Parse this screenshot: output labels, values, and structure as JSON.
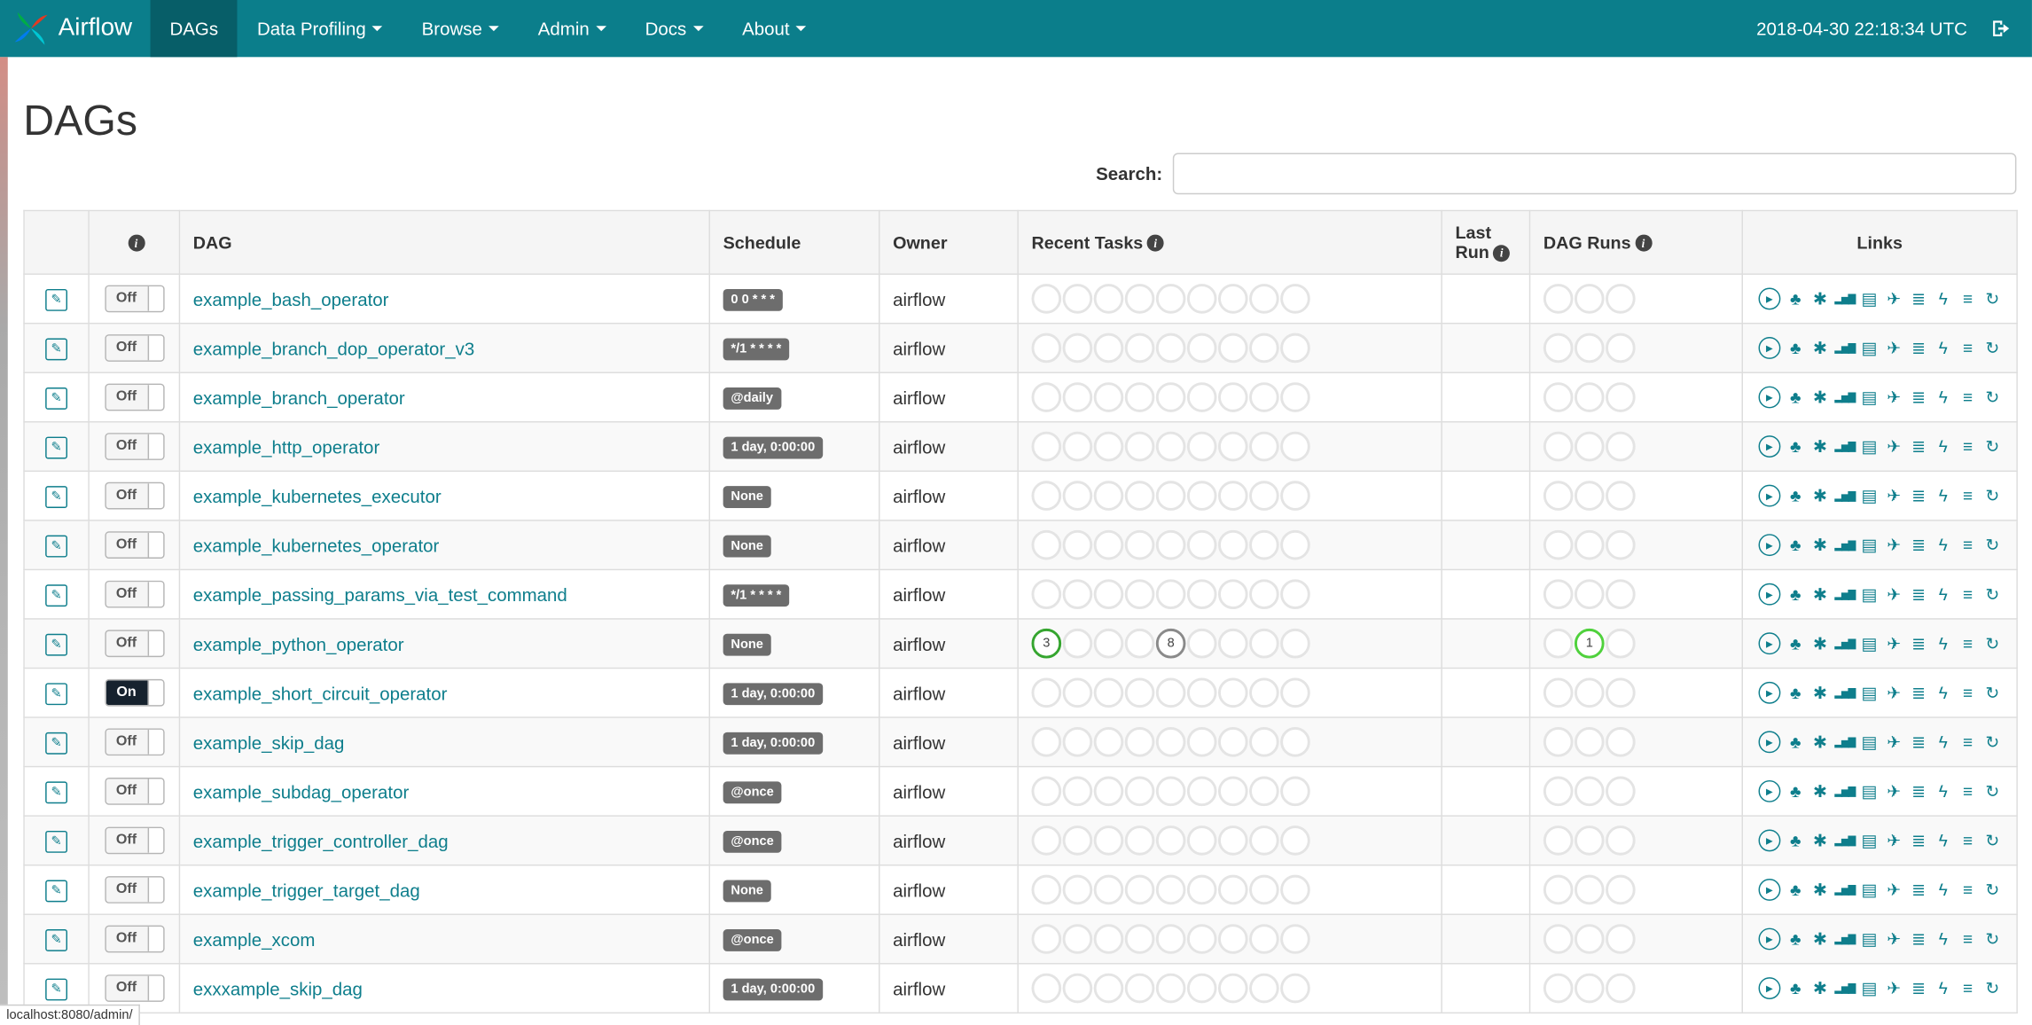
{
  "colors": {
    "navbar": "#0b7e8b",
    "accent": "#0e7e8c",
    "badge": "#6d6d6d",
    "success_green": "#35a52f",
    "run_green": "#4fd13c",
    "neutral_grey": "#8a8a8a"
  },
  "navbar": {
    "brand": "Airflow",
    "items": [
      {
        "label": "DAGs",
        "active": true,
        "dropdown": false
      },
      {
        "label": "Data Profiling",
        "active": false,
        "dropdown": true
      },
      {
        "label": "Browse",
        "active": false,
        "dropdown": true
      },
      {
        "label": "Admin",
        "active": false,
        "dropdown": true
      },
      {
        "label": "Docs",
        "active": false,
        "dropdown": true
      },
      {
        "label": "About",
        "active": false,
        "dropdown": true
      }
    ],
    "clock": "2018-04-30 22:18:34 UTC"
  },
  "page": {
    "title": "DAGs",
    "search_label": "Search:",
    "status_bar": "localhost:8080/admin/"
  },
  "table": {
    "info_glyph": "i",
    "edit_glyph": "✎",
    "headers": {
      "dag": "DAG",
      "schedule": "Schedule",
      "owner": "Owner",
      "recent_tasks": "Recent Tasks",
      "last_run": "Last Run",
      "dag_runs": "DAG Runs",
      "links": "Links"
    },
    "recent_slots": 9,
    "dag_run_slots": 3,
    "links": [
      {
        "name": "trigger-dag-icon",
        "glyph": "▶",
        "circled": true
      },
      {
        "name": "tree-view-icon",
        "glyph": "♣"
      },
      {
        "name": "graph-view-icon",
        "glyph": "✱"
      },
      {
        "name": "task-duration-icon",
        "glyph": "▂▅▇"
      },
      {
        "name": "task-tries-icon",
        "glyph": "▤"
      },
      {
        "name": "landing-times-icon",
        "glyph": "✈"
      },
      {
        "name": "gantt-view-icon",
        "glyph": "≣"
      },
      {
        "name": "code-view-icon",
        "glyph": "ϟ"
      },
      {
        "name": "logs-icon",
        "glyph": "≡"
      },
      {
        "name": "refresh-dag-icon",
        "glyph": "↻"
      }
    ],
    "rows": [
      {
        "dag": "example_bash_operator",
        "schedule": "0 0 * * *",
        "owner": "airflow",
        "toggle": "Off",
        "recent_markers": {},
        "dag_run_markers": {}
      },
      {
        "dag": "example_branch_dop_operator_v3",
        "schedule": "*/1 * * * *",
        "owner": "airflow",
        "toggle": "Off",
        "recent_markers": {},
        "dag_run_markers": {}
      },
      {
        "dag": "example_branch_operator",
        "schedule": "@daily",
        "owner": "airflow",
        "toggle": "Off",
        "recent_markers": {},
        "dag_run_markers": {}
      },
      {
        "dag": "example_http_operator",
        "schedule": "1 day, 0:00:00",
        "owner": "airflow",
        "toggle": "Off",
        "recent_markers": {},
        "dag_run_markers": {}
      },
      {
        "dag": "example_kubernetes_executor",
        "schedule": "None",
        "owner": "airflow",
        "toggle": "Off",
        "recent_markers": {},
        "dag_run_markers": {}
      },
      {
        "dag": "example_kubernetes_operator",
        "schedule": "None",
        "owner": "airflow",
        "toggle": "Off",
        "recent_markers": {},
        "dag_run_markers": {}
      },
      {
        "dag": "example_passing_params_via_test_command",
        "schedule": "*/1 * * * *",
        "owner": "airflow",
        "toggle": "Off",
        "recent_markers": {},
        "dag_run_markers": {}
      },
      {
        "dag": "example_python_operator",
        "schedule": "None",
        "owner": "airflow",
        "toggle": "Off",
        "recent_markers": {
          "0": {
            "value": "3",
            "color": "#35a52f"
          },
          "4": {
            "value": "8",
            "color": "#8a8a8a"
          }
        },
        "dag_run_markers": {
          "1": {
            "value": "1",
            "color": "#4fd13c"
          }
        }
      },
      {
        "dag": "example_short_circuit_operator",
        "schedule": "1 day, 0:00:00",
        "owner": "airflow",
        "toggle": "On",
        "recent_markers": {},
        "dag_run_markers": {}
      },
      {
        "dag": "example_skip_dag",
        "schedule": "1 day, 0:00:00",
        "owner": "airflow",
        "toggle": "Off",
        "recent_markers": {},
        "dag_run_markers": {}
      },
      {
        "dag": "example_subdag_operator",
        "schedule": "@once",
        "owner": "airflow",
        "toggle": "Off",
        "recent_markers": {},
        "dag_run_markers": {}
      },
      {
        "dag": "example_trigger_controller_dag",
        "schedule": "@once",
        "owner": "airflow",
        "toggle": "Off",
        "recent_markers": {},
        "dag_run_markers": {}
      },
      {
        "dag": "example_trigger_target_dag",
        "schedule": "None",
        "owner": "airflow",
        "toggle": "Off",
        "recent_markers": {},
        "dag_run_markers": {}
      },
      {
        "dag": "example_xcom",
        "schedule": "@once",
        "owner": "airflow",
        "toggle": "Off",
        "recent_markers": {},
        "dag_run_markers": {}
      },
      {
        "dag": "exxxample_skip_dag",
        "schedule": "1 day, 0:00:00",
        "owner": "airflow",
        "toggle": "Off",
        "recent_markers": {},
        "dag_run_markers": {}
      }
    ]
  }
}
